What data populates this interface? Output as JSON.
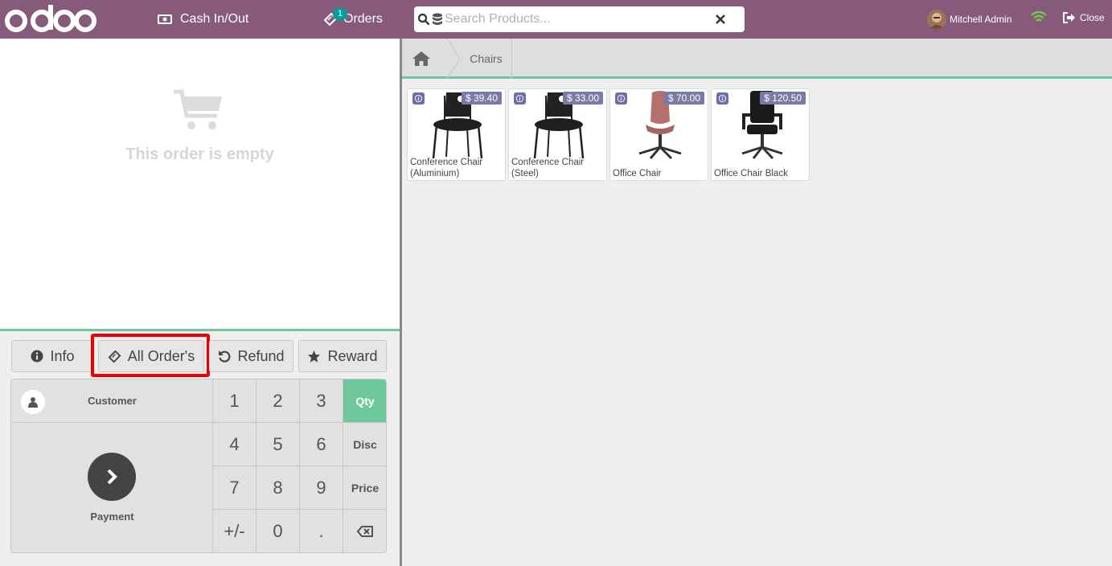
{
  "topbar": {
    "logo_text": "odoo",
    "cash_label": "Cash In/Out",
    "orders_label": "Orders",
    "orders_badge": "1",
    "search_placeholder": "Search Products...",
    "user_name": "Mitchell Admin",
    "close_label": "Close"
  },
  "order": {
    "empty_text": "This order is empty"
  },
  "controls": {
    "info": "Info",
    "all_orders": "All Order's",
    "refund": "Refund",
    "reward": "Reward"
  },
  "pad": {
    "customer": "Customer",
    "payment": "Payment",
    "keys": [
      "1",
      "2",
      "3",
      "4",
      "5",
      "6",
      "7",
      "8",
      "9",
      "+/-",
      "0",
      "."
    ],
    "modes": [
      "Qty",
      "Disc",
      "Price"
    ],
    "active_mode": "Qty"
  },
  "breadcrumb": {
    "category": "Chairs"
  },
  "products": [
    {
      "name": "Conference Chair (Aluminium)",
      "price": "$ 39.40",
      "image": "black-stacking-chair"
    },
    {
      "name": "Conference Chair (Steel)",
      "price": "$ 33.00",
      "image": "black-stacking-chair"
    },
    {
      "name": "Office Chair",
      "price": "$ 70.00",
      "image": "pink-swivel-chair"
    },
    {
      "name": "Office Chair Black",
      "price": "$ 120.50",
      "image": "black-executive-chair"
    }
  ],
  "colors": {
    "brand": "#875a7b",
    "accent": "#6ec89b",
    "price_badge": "#7a7aa8",
    "highlight": "#ee0000"
  }
}
